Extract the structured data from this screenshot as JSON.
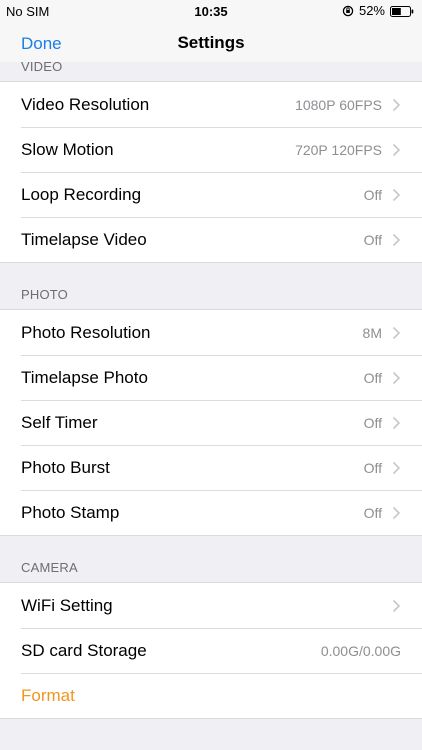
{
  "status": {
    "carrier": "No SIM",
    "time": "10:35",
    "battery": "52%",
    "battery_level": 0.52
  },
  "nav": {
    "done": "Done",
    "title": "Settings"
  },
  "sections": {
    "video": {
      "header": "VIDEO",
      "rows": [
        {
          "label": "Video Resolution",
          "value": "1080P 60FPS"
        },
        {
          "label": "Slow Motion",
          "value": "720P 120FPS"
        },
        {
          "label": "Loop Recording",
          "value": "Off"
        },
        {
          "label": "Timelapse Video",
          "value": "Off"
        }
      ]
    },
    "photo": {
      "header": "PHOTO",
      "rows": [
        {
          "label": "Photo Resolution",
          "value": "8M"
        },
        {
          "label": "Timelapse Photo",
          "value": "Off"
        },
        {
          "label": "Self Timer",
          "value": "Off"
        },
        {
          "label": "Photo Burst",
          "value": "Off"
        },
        {
          "label": "Photo Stamp",
          "value": "Off"
        }
      ]
    },
    "camera": {
      "header": "CAMERA",
      "rows": [
        {
          "label": "WiFi Setting",
          "value": ""
        },
        {
          "label": "SD card Storage",
          "value": "0.00G/0.00G"
        },
        {
          "label": "Format",
          "value": ""
        }
      ]
    }
  },
  "colors": {
    "accent": "#1a7fe6",
    "destructive": "#f0961e",
    "secondary_text": "#8e8e93",
    "background": "#efeff4"
  },
  "icons": [
    "lock-rotation-icon",
    "battery-icon",
    "chevron-right-icon"
  ]
}
